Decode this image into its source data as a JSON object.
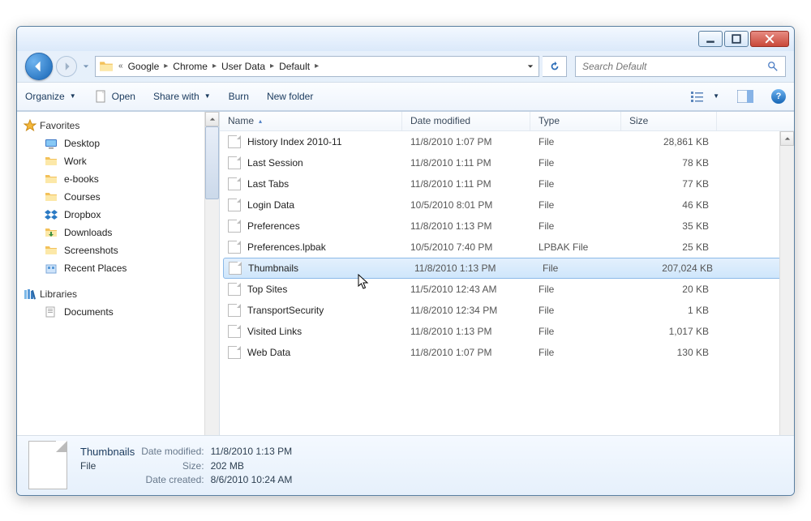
{
  "breadcrumb": {
    "parts": [
      "Google",
      "Chrome",
      "User Data",
      "Default"
    ]
  },
  "search": {
    "placeholder": "Search Default"
  },
  "toolbar": {
    "organize": "Organize",
    "open": "Open",
    "share": "Share with",
    "burn": "Burn",
    "newfolder": "New folder"
  },
  "nav": {
    "favorites": {
      "label": "Favorites",
      "items": [
        "Desktop",
        "Work",
        "e-books",
        "Courses",
        "Dropbox",
        "Downloads",
        "Screenshots",
        "Recent Places"
      ]
    },
    "libraries": {
      "label": "Libraries",
      "items": [
        "Documents"
      ]
    }
  },
  "columns": {
    "name": "Name",
    "date": "Date modified",
    "type": "Type",
    "size": "Size"
  },
  "files": [
    {
      "name": "History Index 2010-11",
      "date": "11/8/2010 1:07 PM",
      "type": "File",
      "size": "28,861 KB"
    },
    {
      "name": "Last Session",
      "date": "11/8/2010 1:11 PM",
      "type": "File",
      "size": "78 KB"
    },
    {
      "name": "Last Tabs",
      "date": "11/8/2010 1:11 PM",
      "type": "File",
      "size": "77 KB"
    },
    {
      "name": "Login Data",
      "date": "10/5/2010 8:01 PM",
      "type": "File",
      "size": "46 KB"
    },
    {
      "name": "Preferences",
      "date": "11/8/2010 1:13 PM",
      "type": "File",
      "size": "35 KB"
    },
    {
      "name": "Preferences.lpbak",
      "date": "10/5/2010 7:40 PM",
      "type": "LPBAK File",
      "size": "25 KB"
    },
    {
      "name": "Thumbnails",
      "date": "11/8/2010 1:13 PM",
      "type": "File",
      "size": "207,024 KB",
      "selected": true
    },
    {
      "name": "Top Sites",
      "date": "11/5/2010 12:43 AM",
      "type": "File",
      "size": "20 KB"
    },
    {
      "name": "TransportSecurity",
      "date": "11/8/2010 12:34 PM",
      "type": "File",
      "size": "1 KB"
    },
    {
      "name": "Visited Links",
      "date": "11/8/2010 1:13 PM",
      "type": "File",
      "size": "1,017 KB"
    },
    {
      "name": "Web Data",
      "date": "11/8/2010 1:07 PM",
      "type": "File",
      "size": "130 KB"
    }
  ],
  "details": {
    "name": "Thumbnails",
    "type": "File",
    "date_modified_label": "Date modified:",
    "date_modified": "11/8/2010 1:13 PM",
    "size_label": "Size:",
    "size": "202 MB",
    "date_created_label": "Date created:",
    "date_created": "8/6/2010 10:24 AM"
  }
}
